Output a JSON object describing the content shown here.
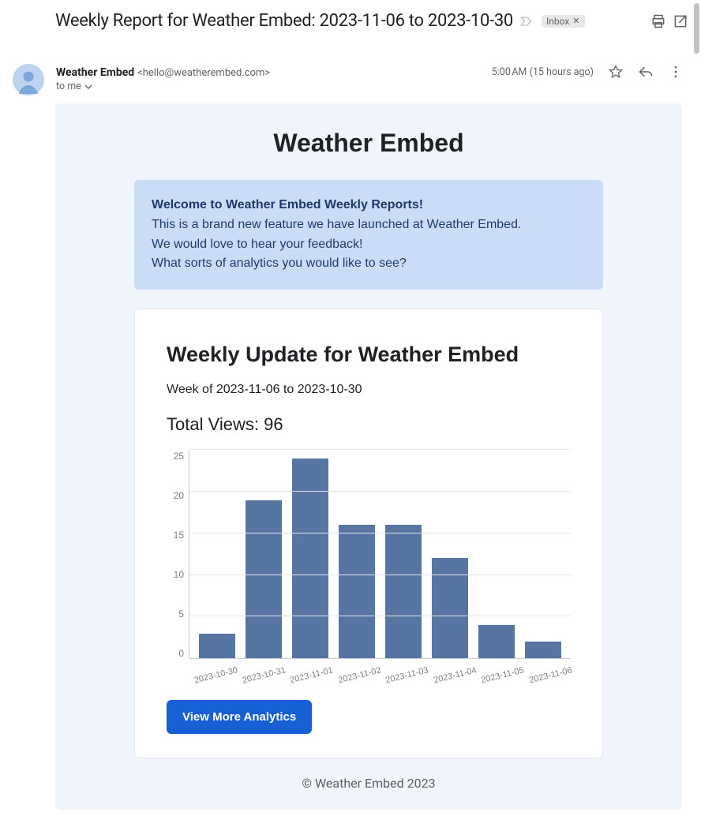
{
  "subject": "Weekly Report for Weather Embed: 2023-11-06 to 2023-10-30",
  "inbox_chip": "Inbox",
  "sender": {
    "name": "Weather Embed",
    "email": "<hello@weatherembed.com>",
    "to": "to me"
  },
  "timestamp": "5:00 AM (15 hours ago)",
  "body": {
    "title": "Weather Embed",
    "welcome": {
      "title": "Welcome to Weather Embed Weekly Reports!",
      "line1": "This is a brand new feature we have launched at Weather Embed.",
      "line2": "We would love to hear your feedback!",
      "line3": "What sorts of analytics you would like to see?"
    },
    "card": {
      "heading": "Weekly Update for Weather Embed",
      "range": "Week of 2023-11-06 to 2023-10-30",
      "total": "Total Views: 96",
      "cta": "View More Analytics"
    },
    "footer": "© Weather Embed 2023"
  },
  "chart_data": {
    "type": "bar",
    "categories": [
      "2023-10-30",
      "2023-10-31",
      "2023-11-01",
      "2023-11-02",
      "2023-11-03",
      "2023-11-04",
      "2023-11-05",
      "2023-11-06"
    ],
    "values": [
      3,
      19,
      24,
      16,
      16,
      12,
      4,
      2
    ],
    "title": "",
    "xlabel": "",
    "ylabel": "",
    "ylim": [
      0,
      25
    ],
    "yticks": [
      0,
      5,
      10,
      15,
      20,
      25
    ]
  }
}
